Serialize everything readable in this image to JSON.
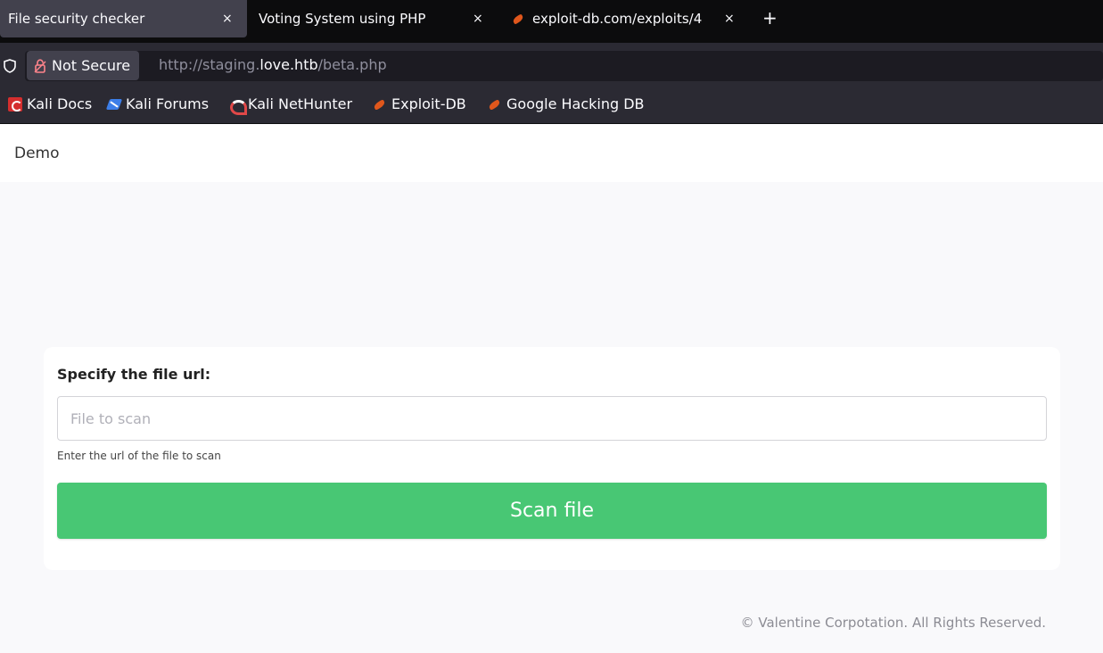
{
  "browser": {
    "tabs": [
      {
        "label": "File security checker",
        "active": true
      },
      {
        "label": "Voting System using PHP",
        "active": false
      },
      {
        "label": "exploit-db.com/exploits/4",
        "active": false
      }
    ],
    "close_glyph": "×",
    "new_tab_glyph": "+",
    "security_label": "Not Secure",
    "url": {
      "scheme": "http://staging.",
      "host": "love.htb",
      "path": "/beta.php"
    },
    "bookmarks": [
      {
        "label": "Kali Docs",
        "icon": "kali-docs-icon"
      },
      {
        "label": "Kali Forums",
        "icon": "kali-forums-icon"
      },
      {
        "label": "Kali NetHunter",
        "icon": "kali-nethunter-icon"
      },
      {
        "label": "Exploit-DB",
        "icon": "exploit-db-icon"
      },
      {
        "label": "Google Hacking DB",
        "icon": "exploit-db-icon"
      }
    ]
  },
  "page": {
    "brand": "Demo",
    "form": {
      "label": "Specify the file url:",
      "input_placeholder": "File to scan",
      "input_value": "",
      "help_text": "Enter the url of the file to scan",
      "button_label": "Scan file"
    },
    "footer": "© Valentine Corpotation. All Rights Reserved."
  },
  "colors": {
    "button": "#48c774",
    "tabbar": "#0c0c0d",
    "toolbar": "#2b2a33"
  }
}
